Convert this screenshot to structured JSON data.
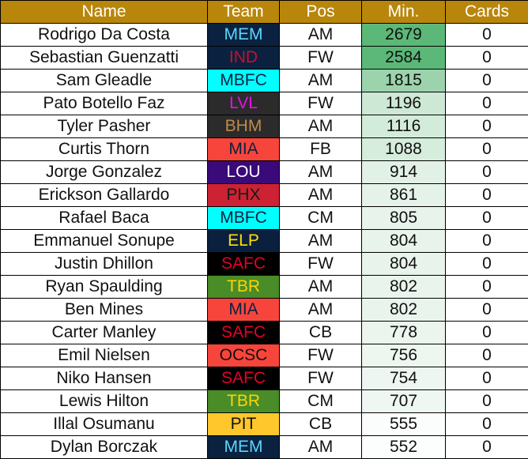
{
  "table": {
    "name": "player-minutes-table",
    "columns": [
      {
        "key": "name",
        "label": "Name"
      },
      {
        "key": "team",
        "label": "Team"
      },
      {
        "key": "pos",
        "label": "Pos"
      },
      {
        "key": "min",
        "label": "Min."
      },
      {
        "key": "cards",
        "label": "Cards"
      }
    ],
    "header_style": {
      "background": "#b8860b",
      "color": "#ffffff"
    },
    "rows": [
      {
        "name": "Rodrigo Da Costa",
        "team": "MEM",
        "pos": "AM",
        "min": "2679",
        "cards": "0",
        "team_bg": "#0a2240",
        "team_fg": "#5bd6ff",
        "min_bg": "#5cb878"
      },
      {
        "name": "Sebastian Guenzatti",
        "team": "IND",
        "pos": "FW",
        "min": "2584",
        "cards": "0",
        "team_bg": "#0a2240",
        "team_fg": "#c8102e",
        "min_bg": "#5cb878"
      },
      {
        "name": "Sam Gleadle",
        "team": "MBFC",
        "pos": "AM",
        "min": "1815",
        "cards": "0",
        "team_bg": "#00ffff",
        "team_fg": "#0a2240",
        "min_bg": "#9cd3ac"
      },
      {
        "name": "Pato Botello Faz",
        "team": "LVL",
        "pos": "FW",
        "min": "1196",
        "cards": "0",
        "team_bg": "#2b2b2b",
        "team_fg": "#e810e8",
        "min_bg": "#cde8d5"
      },
      {
        "name": "Tyler Pasher",
        "team": "BHM",
        "pos": "AM",
        "min": "1116",
        "cards": "0",
        "team_bg": "#2b2b2b",
        "team_fg": "#c08a4a",
        "min_bg": "#d3ebda"
      },
      {
        "name": "Curtis Thorn",
        "team": "MIA",
        "pos": "FB",
        "min": "1088",
        "cards": "0",
        "team_bg": "#f8453c",
        "team_fg": "#0a2240",
        "min_bg": "#d6ecdc"
      },
      {
        "name": "Jorge Gonzalez",
        "team": "LOU",
        "pos": "AM",
        "min": "914",
        "cards": "0",
        "team_bg": "#3a0a7a",
        "team_fg": "#ffffff",
        "min_bg": "#e2f1e6"
      },
      {
        "name": "Erickson Gallardo",
        "team": "PHX",
        "pos": "AM",
        "min": "861",
        "cards": "0",
        "team_bg": "#cc2233",
        "team_fg": "#1a1a1a",
        "min_bg": "#e5f2e9"
      },
      {
        "name": "Rafael Baca",
        "team": "MBFC",
        "pos": "CM",
        "min": "805",
        "cards": "0",
        "team_bg": "#00ffff",
        "team_fg": "#0a2240",
        "min_bg": "#e8f3eb"
      },
      {
        "name": "Emmanuel Sonupe",
        "team": "ELP",
        "pos": "AM",
        "min": "804",
        "cards": "0",
        "team_bg": "#0b1f3f",
        "team_fg": "#ffe000",
        "min_bg": "#e8f3eb"
      },
      {
        "name": "Justin Dhillon",
        "team": "SAFC",
        "pos": "FW",
        "min": "804",
        "cards": "0",
        "team_bg": "#000000",
        "team_fg": "#e4002b",
        "min_bg": "#e8f3eb"
      },
      {
        "name": "Ryan Spaulding",
        "team": "TBR",
        "pos": "AM",
        "min": "802",
        "cards": "0",
        "team_bg": "#4a8c28",
        "team_fg": "#ffd400",
        "min_bg": "#e9f4ec"
      },
      {
        "name": "Ben Mines",
        "team": "MIA",
        "pos": "AM",
        "min": "802",
        "cards": "0",
        "team_bg": "#f8453c",
        "team_fg": "#0a2240",
        "min_bg": "#e9f4ec"
      },
      {
        "name": "Carter Manley",
        "team": "SAFC",
        "pos": "CB",
        "min": "778",
        "cards": "0",
        "team_bg": "#000000",
        "team_fg": "#e4002b",
        "min_bg": "#ebf5ee"
      },
      {
        "name": "Emil Nielsen",
        "team": "OCSC",
        "pos": "FW",
        "min": "756",
        "cards": "0",
        "team_bg": "#f8453c",
        "team_fg": "#111111",
        "min_bg": "#edf6ef"
      },
      {
        "name": "Niko Hansen",
        "team": "SAFC",
        "pos": "FW",
        "min": "754",
        "cards": "0",
        "team_bg": "#000000",
        "team_fg": "#e4002b",
        "min_bg": "#edf6f0"
      },
      {
        "name": "Lewis Hilton",
        "team": "TBR",
        "pos": "CM",
        "min": "707",
        "cards": "0",
        "team_bg": "#4a8c28",
        "team_fg": "#ffd400",
        "min_bg": "#eef7f1"
      },
      {
        "name": "Illal Osumanu",
        "team": "PIT",
        "pos": "CB",
        "min": "555",
        "cards": "0",
        "team_bg": "#ffc72c",
        "team_fg": "#111111",
        "min_bg": "#fbfdfc"
      },
      {
        "name": "Dylan Borczak",
        "team": "MEM",
        "pos": "AM",
        "min": "552",
        "cards": "0",
        "team_bg": "#0a2240",
        "team_fg": "#5bd6ff",
        "min_bg": "#fcfefd"
      }
    ]
  }
}
